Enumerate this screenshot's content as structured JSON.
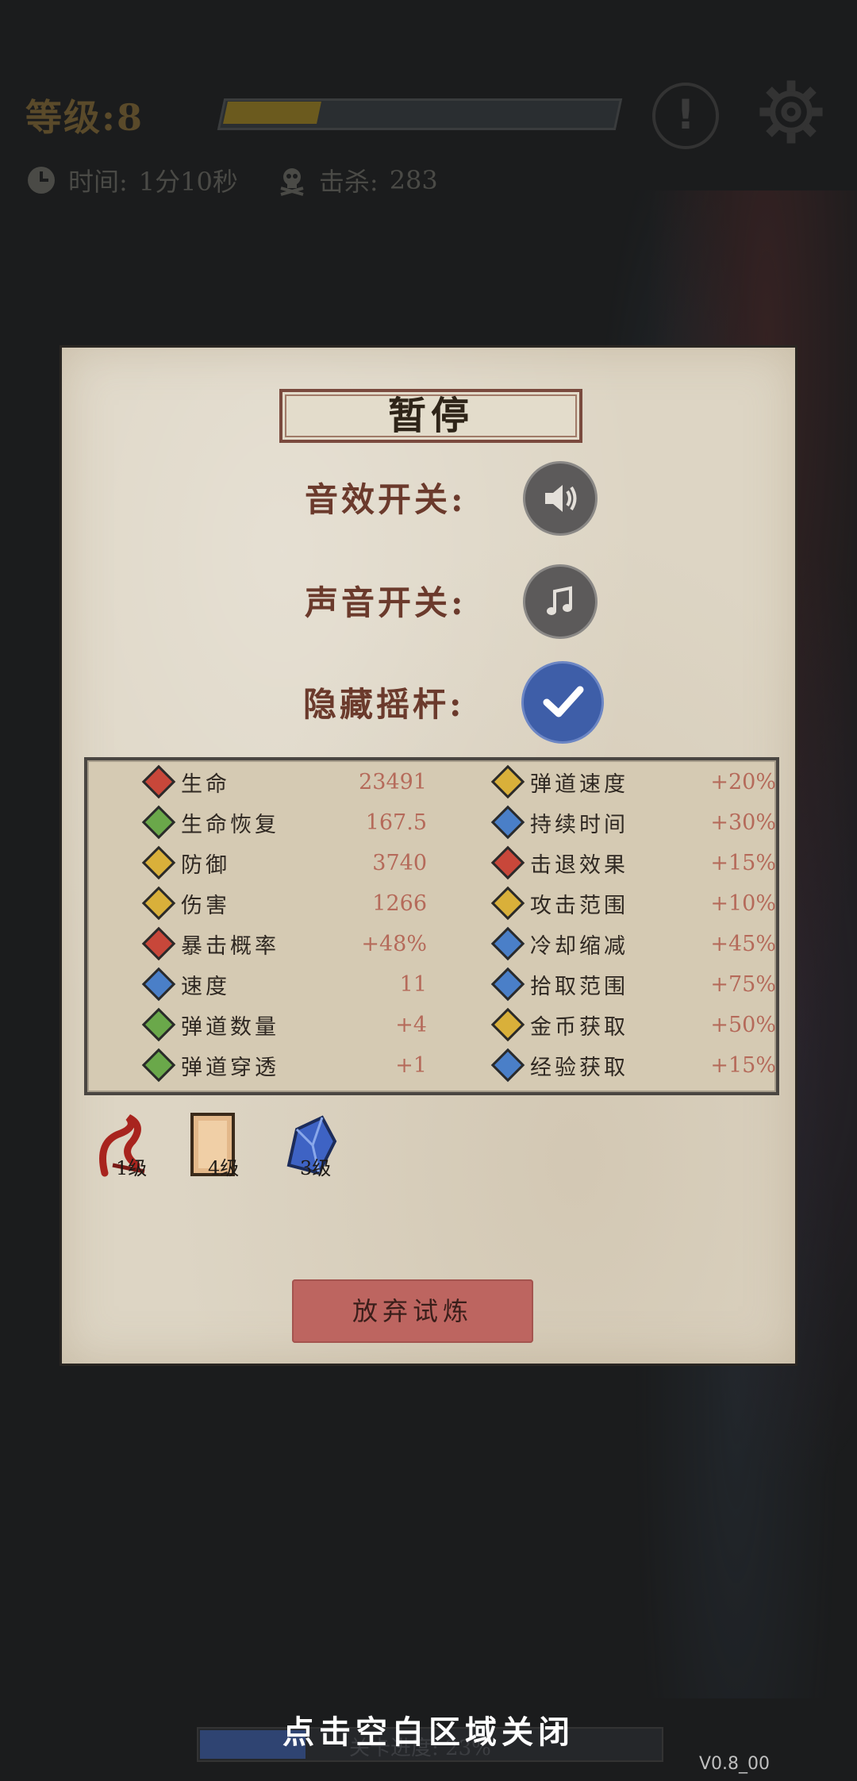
{
  "hud": {
    "level_label": "等级:",
    "level_value": "8",
    "xp_fraction": 0.24,
    "time_label": "时间:",
    "time_value": "1分10秒",
    "kill_label": "击杀:",
    "kill_value": "283"
  },
  "pause": {
    "title": "暂停",
    "sfx_label": "音效开关:",
    "sound_label": "声音开关:",
    "joystick_label": "隐藏摇杆:",
    "joystick_hidden": true
  },
  "stats_left": [
    {
      "name": "生命",
      "value": "23491",
      "icon": "heart-icon",
      "color": "#c8473a"
    },
    {
      "name": "生命恢复",
      "value": "167.5",
      "icon": "regen-icon",
      "color": "#6aa84a"
    },
    {
      "name": "防御",
      "value": "3740",
      "icon": "shield-icon",
      "color": "#d9b03a"
    },
    {
      "name": "伤害",
      "value": "1266",
      "icon": "damage-icon",
      "color": "#d9b03a"
    },
    {
      "name": "暴击概率",
      "value": "+48%",
      "icon": "crit-icon",
      "color": "#c8473a"
    },
    {
      "name": "速度",
      "value": "11",
      "icon": "speed-icon",
      "color": "#4a7fc8"
    },
    {
      "name": "弹道数量",
      "value": "+4",
      "icon": "projectile-count-icon",
      "color": "#6aa84a"
    },
    {
      "name": "弹道穿透",
      "value": "+1",
      "icon": "pierce-icon",
      "color": "#6aa84a"
    }
  ],
  "stats_right": [
    {
      "name": "弹道速度",
      "value": "+20%",
      "icon": "projectile-speed-icon",
      "color": "#d9b03a"
    },
    {
      "name": "持续时间",
      "value": "+30%",
      "icon": "duration-icon",
      "color": "#4a7fc8"
    },
    {
      "name": "击退效果",
      "value": "+15%",
      "icon": "knockback-icon",
      "color": "#c8473a"
    },
    {
      "name": "攻击范围",
      "value": "+10%",
      "icon": "area-icon",
      "color": "#d9b03a"
    },
    {
      "name": "冷却缩减",
      "value": "+45%",
      "icon": "cooldown-icon",
      "color": "#4a7fc8"
    },
    {
      "name": "拾取范围",
      "value": "+75%",
      "icon": "pickup-icon",
      "color": "#4a7fc8"
    },
    {
      "name": "金币获取",
      "value": "+50%",
      "icon": "gold-icon",
      "color": "#d9b03a"
    },
    {
      "name": "经验获取",
      "value": "+15%",
      "icon": "exp-icon",
      "color": "#4a7fc8"
    }
  ],
  "items": [
    {
      "icon": "ribbon-icon",
      "level": "1级"
    },
    {
      "icon": "scroll-icon",
      "level": "4级"
    },
    {
      "icon": "crystal-icon",
      "level": "3级"
    }
  ],
  "quit_label": "放弃试炼",
  "close_hint": "点击空白区域关闭",
  "bottom_progress_text": "关卡进度: 23%",
  "bottom_progress_fraction": 0.23,
  "version": "V0.8_00"
}
